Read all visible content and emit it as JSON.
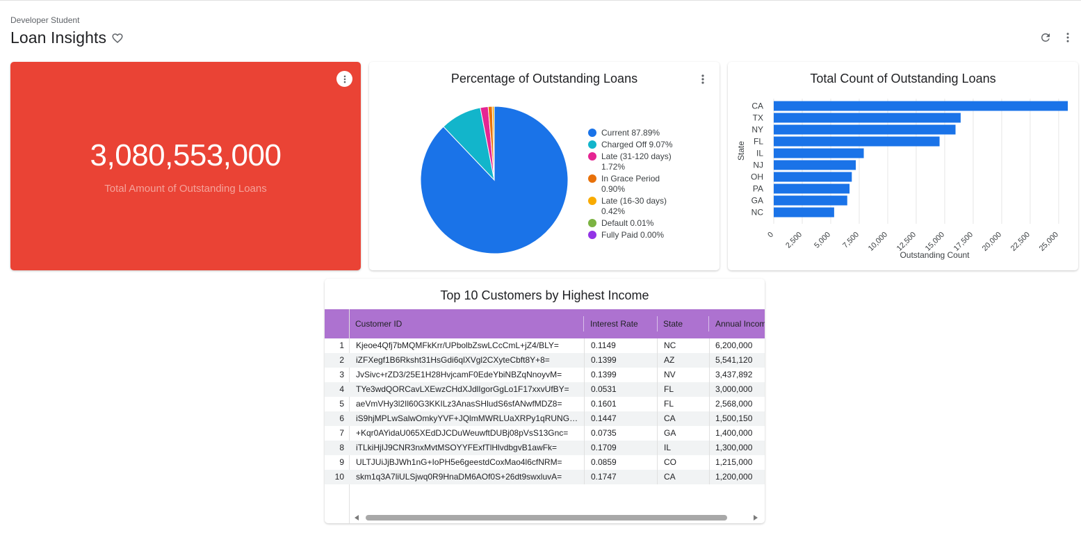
{
  "header": {
    "breadcrumb": "Developer Student",
    "title": "Loan Insights"
  },
  "icons": {
    "favorite": "heart-outline-icon",
    "refresh": "refresh-icon",
    "more": "more-vert-icon"
  },
  "colors": {
    "kpi_background": "#ea4335",
    "bar": "#1a73e8",
    "table_header": "#ad72d0"
  },
  "kpi": {
    "value": "3,080,553,000",
    "label": "Total Amount of Outstanding Loans"
  },
  "pie": {
    "title": "Percentage of Outstanding Loans",
    "legend_lines": [
      [
        "Current 87.89%"
      ],
      [
        "Charged Off 9.07%"
      ],
      [
        "Late (31-120 days)",
        "1.72%"
      ],
      [
        "In Grace Period",
        "0.90%"
      ],
      [
        "Late (16-30 days)",
        "0.42%"
      ],
      [
        "Default 0.01%"
      ],
      [
        "Fully Paid 0.00%"
      ]
    ]
  },
  "bar": {
    "title": "Total Count of Outstanding Loans"
  },
  "table": {
    "title": "Top 10 Customers by Highest Income",
    "columns": [
      "Customer ID",
      "Interest Rate",
      "State",
      "Annual Incom"
    ],
    "rows": [
      {
        "idx": "1",
        "customer_id": "Kjeoe4Qfj7bMQMFkKrr/UPbolbZswLCcCmL+jZ4/BLY=",
        "rate": "0.1149",
        "state": "NC",
        "income": "6,200,000"
      },
      {
        "idx": "2",
        "customer_id": "iZFXegf1B6Rksht31HsGdi6qlXVgl2CXyteCbft8Y+8=",
        "rate": "0.1399",
        "state": "AZ",
        "income": "5,541,120"
      },
      {
        "idx": "3",
        "customer_id": "JvSivc+rZD3/25E1H28HvjcamF0EdeYbiNBZqNnoyvM=",
        "rate": "0.1399",
        "state": "NV",
        "income": "3,437,892"
      },
      {
        "idx": "4",
        "customer_id": "TYe3wdQORCavLXEwzCHdXJdlIgorGgLo1F17xxvUfBY=",
        "rate": "0.0531",
        "state": "FL",
        "income": "3,000,000"
      },
      {
        "idx": "5",
        "customer_id": "aeVmVHy3l2Il60G3KKILz3AnasSHludS6sfANwfMDZ8=",
        "rate": "0.1601",
        "state": "FL",
        "income": "2,568,000"
      },
      {
        "idx": "6",
        "customer_id": "iS9hjMPLwSalwOmkyYVF+JQlmMWRLUaXRPy1qRUNGm…",
        "rate": "0.1447",
        "state": "CA",
        "income": "1,500,150"
      },
      {
        "idx": "7",
        "customer_id": "+Kqr0AYidaU065XEdDJCDuWeuwftDUBj08pVsS13Gnc=",
        "rate": "0.0735",
        "state": "GA",
        "income": "1,400,000"
      },
      {
        "idx": "8",
        "customer_id": "iTLkiHjIJ9CNR3nxMvtMSOYYFExfTlHlvdbgvB1awFk=",
        "rate": "0.1709",
        "state": "IL",
        "income": "1,300,000"
      },
      {
        "idx": "9",
        "customer_id": "ULTJUiJjBJWh1nG+IoPH5e6geestdCoxMao4l6cfNRM=",
        "rate": "0.0859",
        "state": "CO",
        "income": "1,215,000"
      },
      {
        "idx": "10",
        "customer_id": "skm1q3A7liULSjwq0R9HnaDM6AOf0S+26dt9swxluvA=",
        "rate": "0.1747",
        "state": "CA",
        "income": "1,200,000"
      }
    ]
  },
  "chart_data": [
    {
      "type": "pie",
      "title": "Percentage of Outstanding Loans",
      "categories": [
        "Current",
        "Charged Off",
        "Late (31-120 days)",
        "In Grace Period",
        "Late (16-30 days)",
        "Default",
        "Fully Paid"
      ],
      "values": [
        87.89,
        9.07,
        1.72,
        0.9,
        0.42,
        0.01,
        0.0
      ],
      "colors": [
        "#1a73e8",
        "#12b5cb",
        "#e52592",
        "#e8710a",
        "#f9ab00",
        "#7cb342",
        "#9334e6"
      ],
      "legend": "right"
    },
    {
      "type": "bar",
      "orientation": "horizontal",
      "title": "Total Count of Outstanding Loans",
      "categories": [
        "CA",
        "TX",
        "NY",
        "FL",
        "IL",
        "NJ",
        "OH",
        "PA",
        "GA",
        "NC"
      ],
      "values": [
        25800,
        16400,
        15950,
        14550,
        7900,
        7200,
        6850,
        6650,
        6450,
        5300
      ],
      "xlabel": "Outstanding Count",
      "ylabel": "State",
      "xlim": [
        0,
        25800
      ],
      "xticks": [
        "0",
        "2,500",
        "5,000",
        "7,500",
        "10,000",
        "12,500",
        "15,000",
        "17,500",
        "20,000",
        "22,500",
        "25,000"
      ],
      "grid": true
    }
  ]
}
